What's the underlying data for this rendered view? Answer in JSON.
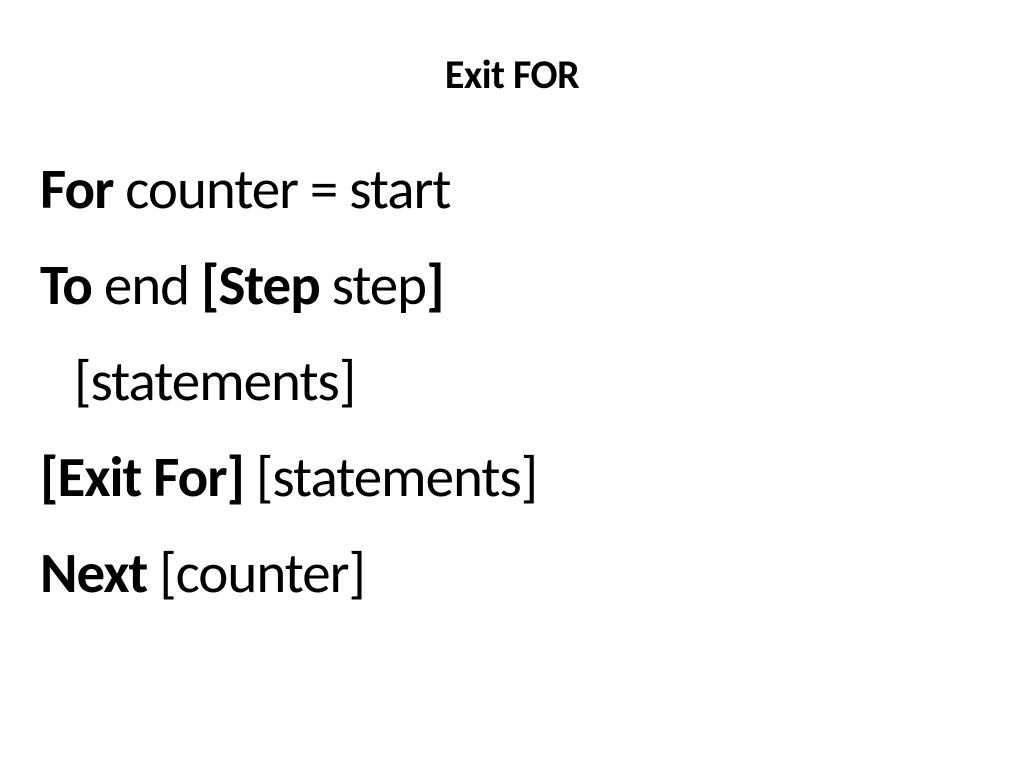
{
  "title": "Exit FOR",
  "lines": {
    "l1": {
      "b1": "For",
      "n1": " counter = start"
    },
    "l2": {
      "b1": "To",
      "n1": " end ",
      "b2": "[Step",
      "n2": " step",
      "b3": "]"
    },
    "l3": {
      "n1": "[statements]"
    },
    "l4": {
      "b1": "[Exit For]",
      "n1": " [statements]"
    },
    "l5": {
      "b1": "Next",
      "n1": " [counter]"
    }
  }
}
